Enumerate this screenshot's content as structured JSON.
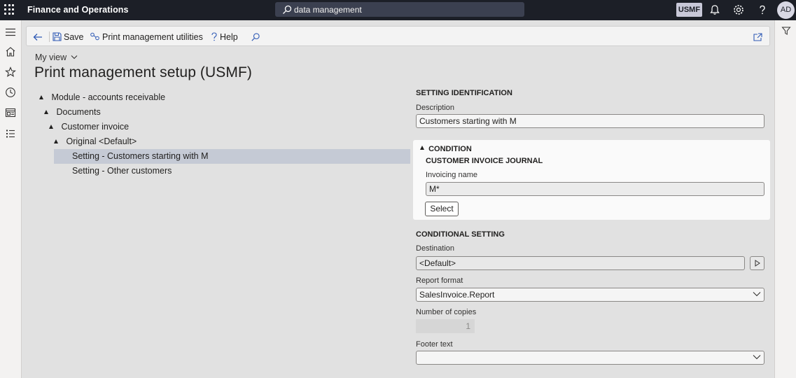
{
  "topbar": {
    "app_title": "Finance and Operations",
    "search_text": "data management",
    "company": "USMF",
    "user_initials": "AD",
    "icons": [
      "waffle-icon",
      "search-icon",
      "bell-icon",
      "gear-icon",
      "help-icon"
    ]
  },
  "leftnav": {
    "items": [
      "hamburger-icon",
      "home-icon",
      "star-icon",
      "clock-icon",
      "workspace-icon",
      "list-icon"
    ]
  },
  "actionpane": {
    "save_label": "Save",
    "print_mgmt_label": "Print management utilities",
    "help_label": "Help"
  },
  "page": {
    "view_label": "My view",
    "title": "Print management setup (USMF)"
  },
  "tree": {
    "items": [
      {
        "label": "Module - accounts receivable",
        "expanded": true
      },
      {
        "label": "Documents",
        "expanded": true
      },
      {
        "label": "Customer invoice",
        "expanded": true
      },
      {
        "label": "Original <Default>",
        "expanded": true
      },
      {
        "label": "Setting - Customers starting with M",
        "selected": true
      },
      {
        "label": "Setting - Other customers"
      }
    ]
  },
  "setting_identification": {
    "heading": "SETTING IDENTIFICATION",
    "description_label": "Description",
    "description_value": "Customers starting with M"
  },
  "condition": {
    "heading": "CONDITION",
    "subheading": "CUSTOMER INVOICE JOURNAL",
    "invoicing_name_label": "Invoicing name",
    "invoicing_name_value": "M*",
    "select_label": "Select"
  },
  "conditional_setting": {
    "heading": "CONDITIONAL SETTING",
    "destination_label": "Destination",
    "destination_value": "<Default>",
    "report_format_label": "Report format",
    "report_format_value": "SalesInvoice.Report",
    "copies_label": "Number of copies",
    "copies_value": "1",
    "footer_label": "Footer text",
    "footer_value": ""
  }
}
